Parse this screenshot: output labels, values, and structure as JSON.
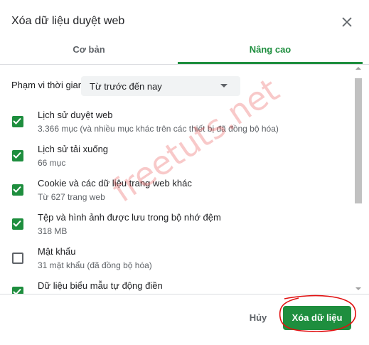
{
  "dialog": {
    "title": "Xóa dữ liệu duyệt web",
    "close_icon": "close-icon"
  },
  "tabs": [
    {
      "label": "Cơ bản",
      "active": false
    },
    {
      "label": "Nâng cao",
      "active": true
    }
  ],
  "time_range": {
    "label": "Phạm vi thời gian",
    "selected": "Từ trước đến nay"
  },
  "items": [
    {
      "label": "Lịch sử duyệt web",
      "sub": "3.366 mục (và nhiều mục khác trên các thiết bị đã đồng bộ hóa)",
      "checked": true
    },
    {
      "label": "Lịch sử tải xuống",
      "sub": "66 mục",
      "checked": true
    },
    {
      "label": "Cookie và các dữ liệu trang web khác",
      "sub": "Từ 627 trang web",
      "checked": true
    },
    {
      "label": "Tệp và hình ảnh được lưu trong bộ nhớ đệm",
      "sub": "318 MB",
      "checked": true
    },
    {
      "label": "Mật khẩu",
      "sub": "31 mật khẩu (đã đồng bộ hóa)",
      "checked": false
    },
    {
      "label": "Dữ liệu biểu mẫu tự động điền",
      "sub": "",
      "checked": true
    }
  ],
  "footer": {
    "cancel_label": "Hủy",
    "clear_label": "Xóa dữ liệu"
  },
  "watermark": "freetuts.net",
  "colors": {
    "accent": "#1e8e3e",
    "annotation": "#e01010"
  }
}
